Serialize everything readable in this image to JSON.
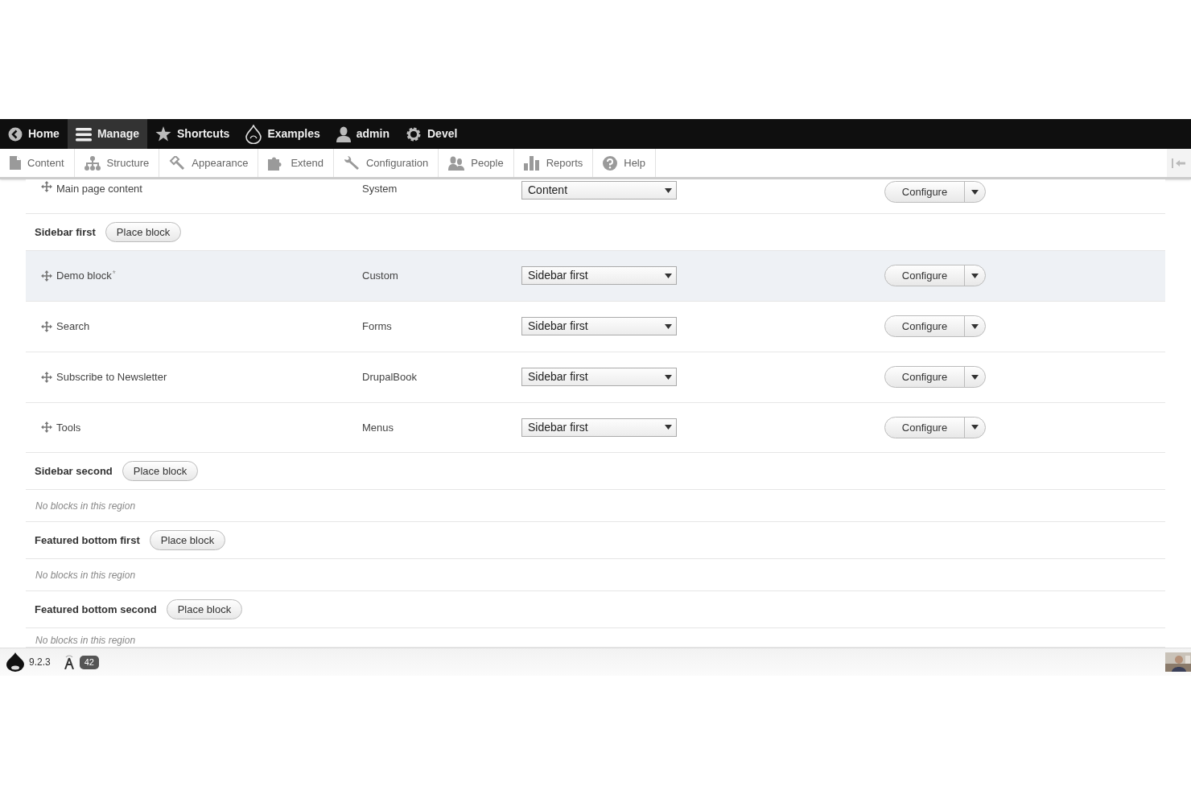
{
  "toolbar": {
    "items": [
      {
        "label": "Home",
        "selected": false
      },
      {
        "label": "Manage",
        "selected": true
      },
      {
        "label": "Shortcuts",
        "selected": false
      },
      {
        "label": "Examples",
        "selected": false
      },
      {
        "label": "admin",
        "selected": false
      },
      {
        "label": "Devel",
        "selected": false
      }
    ]
  },
  "tray": {
    "items": [
      {
        "label": "Content"
      },
      {
        "label": "Structure"
      },
      {
        "label": "Appearance"
      },
      {
        "label": "Extend"
      },
      {
        "label": "Configuration"
      },
      {
        "label": "People"
      },
      {
        "label": "Reports"
      },
      {
        "label": "Help"
      }
    ]
  },
  "blocks": [
    {
      "kind": "block",
      "name": "Main page content",
      "category": "System",
      "region": "Content",
      "button": "Configure",
      "changed": false
    },
    {
      "kind": "region",
      "name": "Sidebar first",
      "button": "Place block"
    },
    {
      "kind": "block",
      "name": "Demo block",
      "mark": "*",
      "category": "Custom",
      "region": "Sidebar first",
      "button": "Configure",
      "changed": true
    },
    {
      "kind": "block",
      "name": "Search",
      "category": "Forms",
      "region": "Sidebar first",
      "button": "Configure",
      "changed": false
    },
    {
      "kind": "block",
      "name": "Subscribe to Newsletter",
      "category": "DrupalBook",
      "region": "Sidebar first",
      "button": "Configure",
      "changed": false
    },
    {
      "kind": "block",
      "name": "Tools",
      "category": "Menus",
      "region": "Sidebar first",
      "button": "Configure",
      "changed": false
    },
    {
      "kind": "region",
      "name": "Sidebar second",
      "button": "Place block"
    },
    {
      "kind": "empty",
      "text": "No blocks in this region"
    },
    {
      "kind": "region",
      "name": "Featured bottom first",
      "button": "Place block"
    },
    {
      "kind": "empty",
      "text": "No blocks in this region"
    },
    {
      "kind": "region",
      "name": "Featured bottom second",
      "button": "Place block"
    },
    {
      "kind": "empty",
      "text": "No blocks in this region"
    }
  ],
  "footer": {
    "version": "9.2.3",
    "count": "42"
  }
}
